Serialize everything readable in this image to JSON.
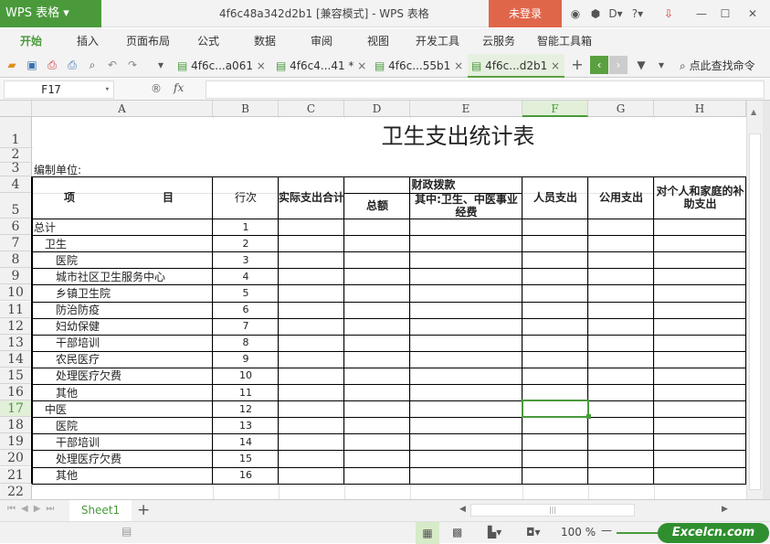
{
  "app": {
    "logo": "WPS 表格",
    "window_title": "4f6c48a342d2b1 [兼容模式] - WPS 表格",
    "login": "未登录"
  },
  "menu": [
    "开始",
    "插入",
    "页面布局",
    "公式",
    "数据",
    "审阅",
    "视图",
    "开发工具",
    "云服务",
    "智能工具箱"
  ],
  "doc_tabs": [
    {
      "label": "4f6c...a061",
      "active": false
    },
    {
      "label": "4f6c4...41 *",
      "active": false
    },
    {
      "label": "4f6c...55b1",
      "active": false
    },
    {
      "label": "4f6c...d2b1",
      "active": true
    }
  ],
  "search_cmd": "点此查找命令",
  "formula": {
    "cell_ref": "F17",
    "fx": "fx",
    "value": ""
  },
  "columns": [
    "A",
    "B",
    "C",
    "D",
    "E",
    "F",
    "G",
    "H"
  ],
  "selected_column": "F",
  "selected_row": 17,
  "row_numbers": [
    1,
    2,
    3,
    4,
    5,
    6,
    7,
    8,
    9,
    10,
    11,
    12,
    13,
    14,
    15,
    16,
    17,
    18,
    19,
    20,
    21,
    22
  ],
  "sheet": {
    "title": "卫生支出统计表",
    "unit_label": "编制单位:",
    "headers": {
      "item_left": "项",
      "item_right": "目",
      "line_no": "行次",
      "actual_total": "实际支出合计",
      "fiscal": "财政拨款",
      "fiscal_total": "总额",
      "fiscal_sub": "其中:卫生、中医事业经费",
      "personnel": "人员支出",
      "public": "公用支出",
      "household": "对个人和家庭的补助支出"
    },
    "rows": [
      {
        "name": "总计",
        "indent": 0,
        "no": "1"
      },
      {
        "name": "卫生",
        "indent": 1,
        "no": "2"
      },
      {
        "name": "医院",
        "indent": 2,
        "no": "3"
      },
      {
        "name": "城市社区卫生服务中心",
        "indent": 2,
        "no": "4"
      },
      {
        "name": "乡镇卫生院",
        "indent": 2,
        "no": "5"
      },
      {
        "name": "防治防疫",
        "indent": 2,
        "no": "6"
      },
      {
        "name": "妇幼保健",
        "indent": 2,
        "no": "7"
      },
      {
        "name": "干部培训",
        "indent": 2,
        "no": "8"
      },
      {
        "name": "农民医疗",
        "indent": 2,
        "no": "9"
      },
      {
        "name": "处理医疗欠费",
        "indent": 2,
        "no": "10"
      },
      {
        "name": "其他",
        "indent": 2,
        "no": "11"
      },
      {
        "name": "中医",
        "indent": 1,
        "no": "12"
      },
      {
        "name": "医院",
        "indent": 2,
        "no": "13"
      },
      {
        "name": "干部培训",
        "indent": 2,
        "no": "14"
      },
      {
        "name": "处理医疗欠费",
        "indent": 2,
        "no": "15"
      },
      {
        "name": "其他",
        "indent": 2,
        "no": "16"
      }
    ]
  },
  "sheet_tabs": [
    "Sheet1"
  ],
  "status": {
    "zoom": "100 %",
    "watermark": "Excelcn.com"
  },
  "colors": {
    "accent": "#4a9a3c",
    "login": "#e0664a"
  }
}
